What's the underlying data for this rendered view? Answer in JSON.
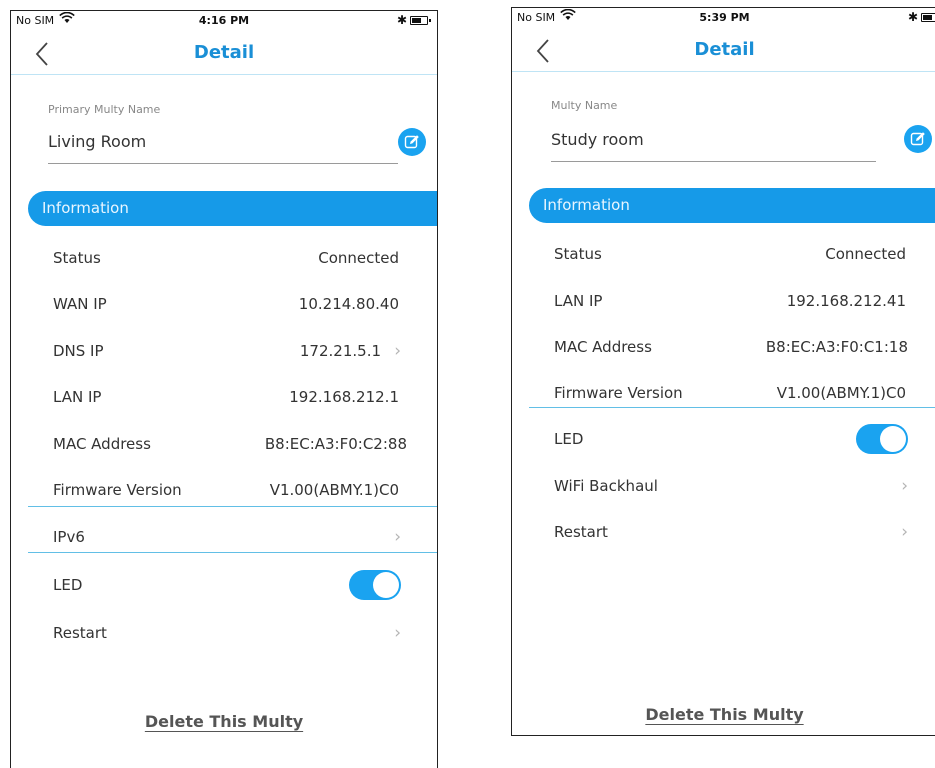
{
  "left_screen": {
    "status_bar": {
      "carrier": "No SIM",
      "time": "4:16 PM"
    },
    "nav": {
      "title": "Detail"
    },
    "name_field": {
      "label": "Primary Multy Name",
      "value": "Living Room"
    },
    "info_header": "Information",
    "rows": [
      {
        "label": "Status",
        "value": "Connected"
      },
      {
        "label": "WAN IP",
        "value": "10.214.80.40"
      },
      {
        "label": "DNS IP",
        "value": "172.21.5.1"
      },
      {
        "label": "LAN IP",
        "value": "192.168.212.1"
      },
      {
        "label": "MAC Address",
        "value": "B8:EC:A3:F0:C2:88"
      },
      {
        "label": "Firmware Version",
        "value": "V1.00(ABMY.1)C0"
      }
    ],
    "ipv6_label": "IPv6",
    "led_label": "LED",
    "led_on": true,
    "restart_label": "Restart",
    "delete_label": "Delete This Multy"
  },
  "right_screen": {
    "status_bar": {
      "carrier": "No SIM",
      "time": "5:39 PM"
    },
    "nav": {
      "title": "Detail"
    },
    "name_field": {
      "label": "Multy Name",
      "value": "Study room"
    },
    "info_header": "Information",
    "rows": [
      {
        "label": "Status",
        "value": "Connected"
      },
      {
        "label": "LAN IP",
        "value": "192.168.212.41"
      },
      {
        "label": "MAC Address",
        "value": "B8:EC:A3:F0:C1:18"
      },
      {
        "label": "Firmware Version",
        "value": "V1.00(ABMY.1)C0"
      }
    ],
    "led_label": "LED",
    "led_on": true,
    "wifi_backhaul_label": "WiFi Backhaul",
    "restart_label": "Restart",
    "delete_label": "Delete This Multy"
  },
  "colors": {
    "accent": "#169ae8",
    "title": "#1a8fd6",
    "divider": "#62bfe6"
  },
  "icons": [
    "wifi-icon",
    "bluetooth-icon",
    "battery-icon",
    "back-chevron-icon",
    "edit-icon",
    "chevron-right-icon"
  ]
}
